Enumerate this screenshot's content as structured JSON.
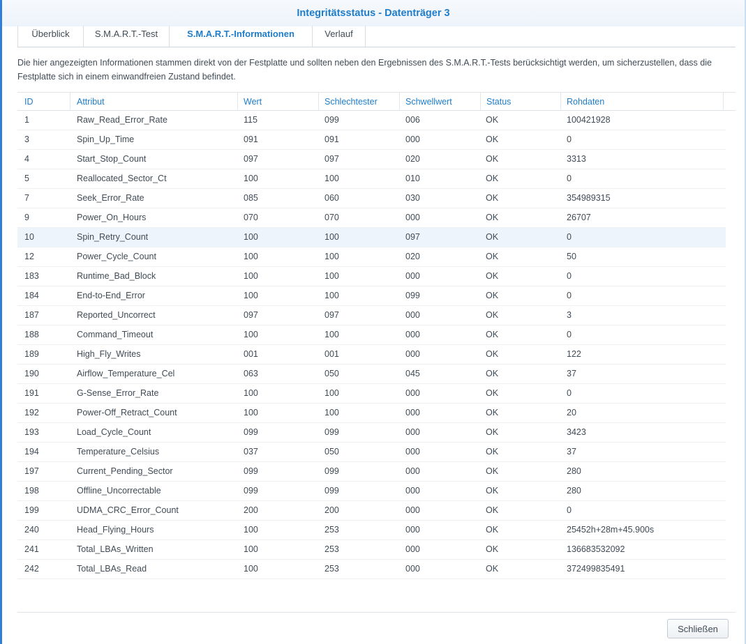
{
  "window": {
    "title": "Integritätsstatus - Datenträger 3"
  },
  "tabs": [
    {
      "label": "Überblick"
    },
    {
      "label": "S.M.A.R.T.-Test"
    },
    {
      "label": "S.M.A.R.T.-Informationen",
      "active": true
    },
    {
      "label": "Verlauf"
    }
  ],
  "description": "Die hier angezeigten Informationen stammen direkt von der Festplatte und sollten neben den Ergebnissen des S.M.A.R.T.-Tests berücksichtigt werden, um sicherzustellen, dass die Festplatte sich in einem einwandfreien Zustand befindet.",
  "table": {
    "headers": [
      "ID",
      "Attribut",
      "Wert",
      "Schlechtester",
      "Schwellwert",
      "Status",
      "Rohdaten"
    ],
    "rows": [
      [
        "1",
        "Raw_Read_Error_Rate",
        "115",
        "099",
        "006",
        "OK",
        "100421928"
      ],
      [
        "3",
        "Spin_Up_Time",
        "091",
        "091",
        "000",
        "OK",
        "0"
      ],
      [
        "4",
        "Start_Stop_Count",
        "097",
        "097",
        "020",
        "OK",
        "3313"
      ],
      [
        "5",
        "Reallocated_Sector_Ct",
        "100",
        "100",
        "010",
        "OK",
        "0"
      ],
      [
        "7",
        "Seek_Error_Rate",
        "085",
        "060",
        "030",
        "OK",
        "354989315"
      ],
      [
        "9",
        "Power_On_Hours",
        "070",
        "070",
        "000",
        "OK",
        "26707"
      ],
      [
        "10",
        "Spin_Retry_Count",
        "100",
        "100",
        "097",
        "OK",
        "0"
      ],
      [
        "12",
        "Power_Cycle_Count",
        "100",
        "100",
        "020",
        "OK",
        "50"
      ],
      [
        "183",
        "Runtime_Bad_Block",
        "100",
        "100",
        "000",
        "OK",
        "0"
      ],
      [
        "184",
        "End-to-End_Error",
        "100",
        "100",
        "099",
        "OK",
        "0"
      ],
      [
        "187",
        "Reported_Uncorrect",
        "097",
        "097",
        "000",
        "OK",
        "3"
      ],
      [
        "188",
        "Command_Timeout",
        "100",
        "100",
        "000",
        "OK",
        "0"
      ],
      [
        "189",
        "High_Fly_Writes",
        "001",
        "001",
        "000",
        "OK",
        "122"
      ],
      [
        "190",
        "Airflow_Temperature_Cel",
        "063",
        "050",
        "045",
        "OK",
        "37"
      ],
      [
        "191",
        "G-Sense_Error_Rate",
        "100",
        "100",
        "000",
        "OK",
        "0"
      ],
      [
        "192",
        "Power-Off_Retract_Count",
        "100",
        "100",
        "000",
        "OK",
        "20"
      ],
      [
        "193",
        "Load_Cycle_Count",
        "099",
        "099",
        "000",
        "OK",
        "3423"
      ],
      [
        "194",
        "Temperature_Celsius",
        "037",
        "050",
        "000",
        "OK",
        "37"
      ],
      [
        "197",
        "Current_Pending_Sector",
        "099",
        "099",
        "000",
        "OK",
        "280"
      ],
      [
        "198",
        "Offline_Uncorrectable",
        "099",
        "099",
        "000",
        "OK",
        "280"
      ],
      [
        "199",
        "UDMA_CRC_Error_Count",
        "200",
        "200",
        "000",
        "OK",
        "0"
      ],
      [
        "240",
        "Head_Flying_Hours",
        "100",
        "253",
        "000",
        "OK",
        "25452h+28m+45.900s"
      ],
      [
        "241",
        "Total_LBAs_Written",
        "100",
        "253",
        "000",
        "OK",
        "136683532092"
      ],
      [
        "242",
        "Total_LBAs_Read",
        "100",
        "253",
        "000",
        "OK",
        "372499835491"
      ]
    ],
    "highlighted_row_index": 6
  },
  "footer": {
    "close_label": "Schließen"
  },
  "colors": {
    "accent": "#1f7dc9",
    "text": "#414b55",
    "row_highlight": "#eef4fb",
    "window_border": "#2f7fd8"
  }
}
